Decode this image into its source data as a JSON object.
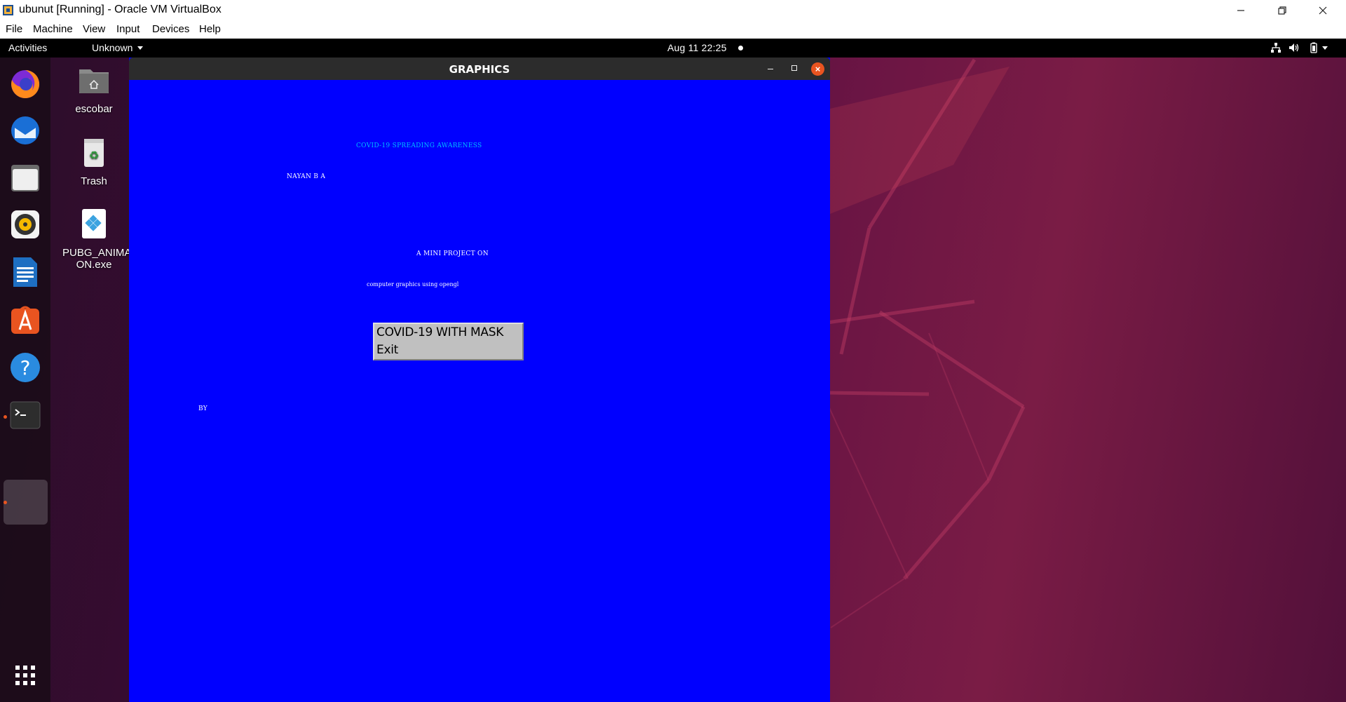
{
  "host": {
    "title": "ubunut [Running] - Oracle VM VirtualBox",
    "menu": [
      "File",
      "Machine",
      "View",
      "Input",
      "Devices",
      "Help"
    ]
  },
  "topbar": {
    "activities": "Activities",
    "app_menu": "Unknown",
    "clock": "Aug 11  22:25"
  },
  "dock": {
    "items": [
      "firefox-icon",
      "thunderbird-icon",
      "files-icon",
      "rhythmbox-icon",
      "writer-icon",
      "software-icon",
      "help-icon",
      "terminal-icon",
      "active-app-icon",
      "show-apps-icon"
    ]
  },
  "desktop": {
    "icons": [
      {
        "label": "escobar",
        "icon": "home-folder-icon"
      },
      {
        "label": "Trash",
        "icon": "trash-icon"
      },
      {
        "label": "PUBG_ANIMAI-ON.exe",
        "icon": "exe-file-icon"
      }
    ]
  },
  "graphics_window": {
    "title": "GRAPHICS",
    "texts": {
      "heading": "COVID-19 SPREADING AWARENESS",
      "name": "NAYAN B A",
      "subtitle": "A MINI PROJECT ON",
      "topic": "computer graphics using opengl",
      "by": "BY"
    },
    "context_menu": {
      "item1": "COVID-19 WITH MASK",
      "item2": "Exit"
    }
  },
  "colors": {
    "canvas": "#0000ff",
    "heading_text": "#00bfff",
    "accent": "#e95420"
  }
}
